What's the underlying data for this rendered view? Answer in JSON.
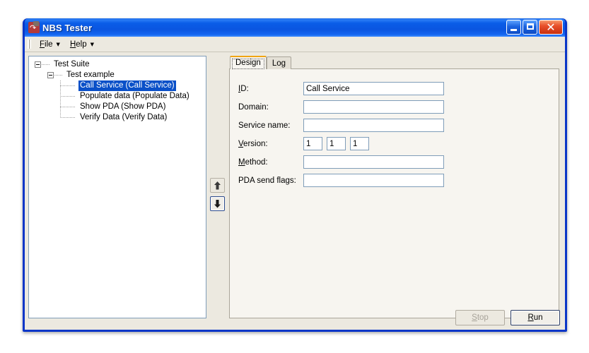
{
  "window": {
    "title": "NBS Tester",
    "icon": "app-arrow-icon",
    "buttons": {
      "minimize": "minimize-icon",
      "maximize": "maximize-icon",
      "close": "close-icon"
    }
  },
  "menubar": {
    "items": [
      {
        "label": "File",
        "mnemonic": "F",
        "caret": "▼"
      },
      {
        "label": "Help",
        "mnemonic": "H",
        "caret": "▼"
      }
    ]
  },
  "tree": {
    "nodes": [
      {
        "label": "Test Suite",
        "level": 0,
        "expanded": true,
        "selected": false
      },
      {
        "label": "Test example",
        "level": 1,
        "expanded": true,
        "selected": false
      },
      {
        "label": "Call Service (Call Service)",
        "level": 2,
        "expanded": null,
        "selected": true
      },
      {
        "label": "Populate data (Populate Data)",
        "level": 2,
        "expanded": null,
        "selected": false
      },
      {
        "label": "Show PDA (Show PDA)",
        "level": 2,
        "expanded": null,
        "selected": false
      },
      {
        "label": "Verify Data (Verify Data)",
        "level": 2,
        "expanded": null,
        "selected": false
      }
    ],
    "selection_color": "#0A50C8"
  },
  "reorder": {
    "up_label": "move-up",
    "down_label": "move-down",
    "down_focused": true
  },
  "tabs": [
    {
      "label": "Design",
      "active": true
    },
    {
      "label": "Log",
      "active": false
    }
  ],
  "form": {
    "fields": [
      {
        "label": "ID:",
        "mnemonic": "I",
        "value": "Call Service",
        "placeholder": ""
      },
      {
        "label": "Domain:",
        "mnemonic": "",
        "value": "",
        "placeholder": ""
      },
      {
        "label": "Service name:",
        "mnemonic": "",
        "value": "",
        "placeholder": ""
      },
      {
        "label": "Method:",
        "mnemonic": "M",
        "value": "",
        "placeholder": ""
      },
      {
        "label": "PDA send flags:",
        "mnemonic": "",
        "value": "",
        "placeholder": ""
      }
    ],
    "version": {
      "label": "Version:",
      "mnemonic": "V",
      "values": [
        "1",
        "1",
        "1"
      ]
    }
  },
  "footer": {
    "stop": {
      "label": "Stop",
      "mnemonic": "S",
      "enabled": false
    },
    "run": {
      "label": "Run",
      "mnemonic": "R",
      "enabled": true,
      "default": true
    }
  },
  "colors": {
    "title_blue": "#0A55E0",
    "frame_blue": "#0A36C8",
    "face": "#ECE9E0",
    "panel": "#F7F5F0",
    "field_border": "#7f9db9",
    "tab_accent": "#F0A513"
  }
}
